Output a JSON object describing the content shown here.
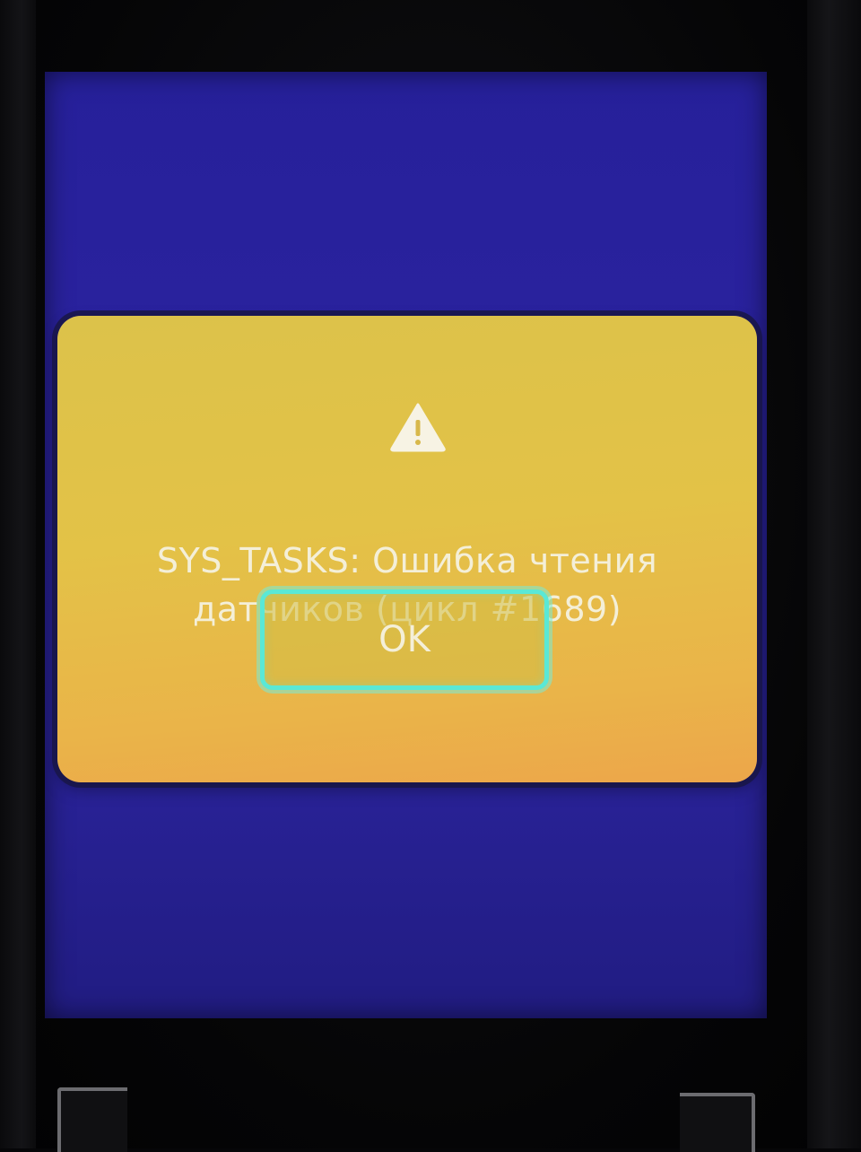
{
  "dialog": {
    "icon": "warning-triangle-icon",
    "message": "SYS_TASKS: Ошибка чтения датчиков (цикл #1689)",
    "ok_label": "OK"
  },
  "colors": {
    "screen_background": "#2a229e",
    "dialog_background": "#e3c247",
    "dialog_gradient_end": "#eca64a",
    "text": "#f4efd8",
    "button_focus_border": "#5ae8d6"
  }
}
